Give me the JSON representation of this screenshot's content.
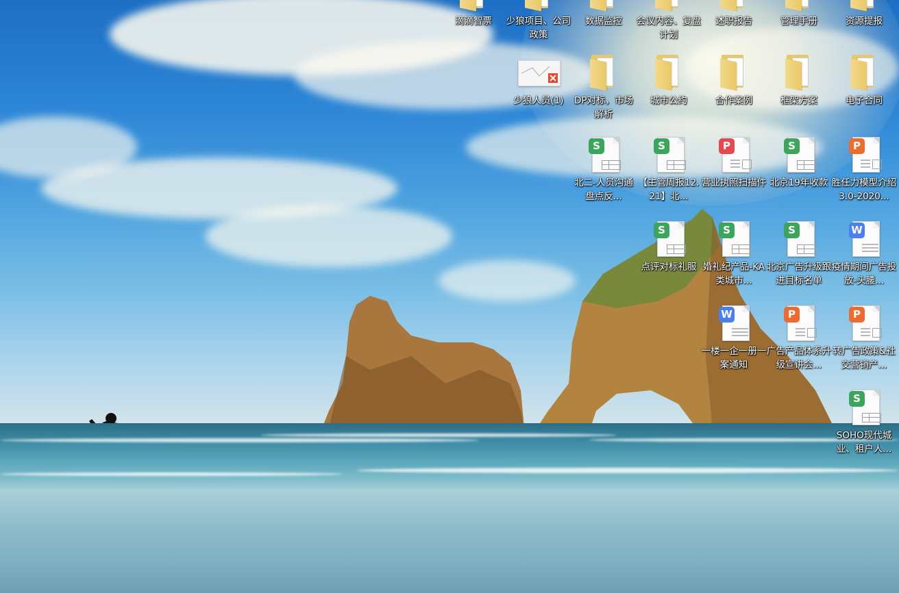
{
  "desktop": {
    "icons": [
      {
        "label": "滴滴智票",
        "type": "folder",
        "accent": "#3aa55b",
        "col": 0,
        "row": 0
      },
      {
        "label": "少狼项目、公司政策",
        "type": "folder",
        "accent": "#3aa55b",
        "col": 1,
        "row": 0
      },
      {
        "label": "数据监控",
        "type": "folder",
        "accent": "#3aa55b",
        "col": 2,
        "row": 0
      },
      {
        "label": "会议内容、复盘计划",
        "type": "folder",
        "accent": "#3aa55b",
        "col": 3,
        "row": 0
      },
      {
        "label": "述职报告",
        "type": "folder",
        "accent": "#3aa55b",
        "col": 4,
        "row": 0
      },
      {
        "label": "管理手册",
        "type": "folder",
        "accent": "#3aa55b",
        "col": 5,
        "row": 0
      },
      {
        "label": "资源提报",
        "type": "folder",
        "accent": "#3aa55b",
        "col": 6,
        "row": 0
      },
      {
        "label": "少狼人员(1)",
        "type": "image",
        "accent": "#e8452b",
        "col": 1,
        "row": 1
      },
      {
        "label": "DP对标，市场解析",
        "type": "folder",
        "accent": "#3aa55b",
        "col": 2,
        "row": 1
      },
      {
        "label": "城市公约",
        "type": "folder",
        "accent": "#3aa55b",
        "col": 3,
        "row": 1
      },
      {
        "label": "合作案例",
        "type": "folder",
        "accent": "#3b82d6",
        "col": 4,
        "row": 1
      },
      {
        "label": "框架方案",
        "type": "folder",
        "accent": "#3aa55b",
        "col": 5,
        "row": 1
      },
      {
        "label": "电子合同",
        "type": "folder",
        "accent": "#3b82d6",
        "col": 6,
        "row": 1
      },
      {
        "label": "北二-人员沟通盘点反...",
        "type": "sheet",
        "badge": "S",
        "accent": "#3aa55b",
        "col": 2,
        "row": 2
      },
      {
        "label": "【主管周报12.21】北...",
        "type": "sheet",
        "badge": "S",
        "accent": "#3aa55b",
        "col": 3,
        "row": 2
      },
      {
        "label": "营业执照扫描件",
        "type": "pdf",
        "badge": "P",
        "accent": "#e5484d",
        "col": 4,
        "row": 2
      },
      {
        "label": "北京19年收款",
        "type": "sheet",
        "badge": "S",
        "accent": "#3aa55b",
        "col": 5,
        "row": 2
      },
      {
        "label": "胜任力模型介绍3.0-2020...",
        "type": "slides",
        "badge": "P",
        "accent": "#ee6a2e",
        "col": 6,
        "row": 2
      },
      {
        "label": "点评对标礼服",
        "type": "sheet",
        "badge": "S",
        "accent": "#3aa55b",
        "col": 3,
        "row": 3
      },
      {
        "label": "婚礼纪产品-KA类城市...",
        "type": "sheet",
        "badge": "S",
        "accent": "#3aa55b",
        "col": 4,
        "row": 3
      },
      {
        "label": "北京广告升级跟进目标名单",
        "type": "sheet",
        "badge": "S",
        "accent": "#3aa55b",
        "col": 5,
        "row": 3
      },
      {
        "label": "疫情期间广告投放-头腰...",
        "type": "word",
        "badge": "W",
        "accent": "#4a7ff0",
        "col": 6,
        "row": 3
      },
      {
        "label": "一楼一企一册一案通知",
        "type": "word",
        "badge": "W",
        "accent": "#4a7ff0",
        "col": 4,
        "row": 4
      },
      {
        "label": "广告产品体系升级宣讲会...",
        "type": "slides",
        "badge": "P",
        "accent": "#ee6a2e",
        "col": 5,
        "row": 4
      },
      {
        "label": "转广告政策&社交营销产...",
        "type": "slides",
        "badge": "P",
        "accent": "#ee6a2e",
        "col": 6,
        "row": 4
      },
      {
        "label": "SOHO现代城业、租户人...",
        "type": "sheet",
        "badge": "S",
        "accent": "#3aa55b",
        "col": 6,
        "row": 5
      }
    ]
  }
}
